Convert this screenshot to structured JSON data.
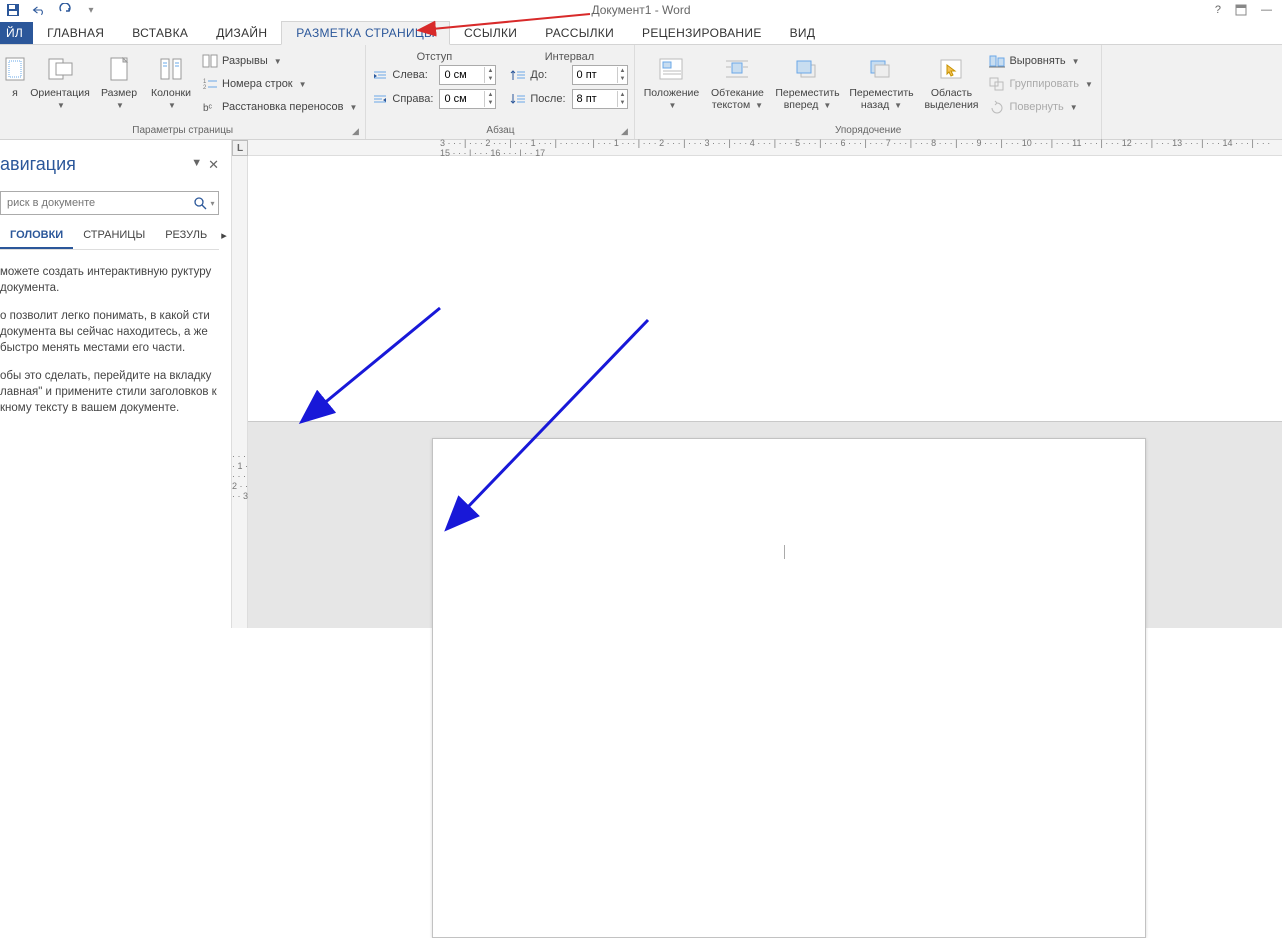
{
  "title": "Документ1 - Word",
  "tabs": {
    "file": "йл",
    "home": "ГЛАВНАЯ",
    "insert": "ВСТАВКА",
    "design": "ДИЗАЙН",
    "layout": "РАЗМЕТКА СТРАНИЦЫ",
    "links": "ССЫЛКИ",
    "mailings": "РАССЫЛКИ",
    "review": "РЕЦЕНЗИРОВАНИЕ",
    "view": "ВИД"
  },
  "ribbon": {
    "page_setup": {
      "margins_btn": "я",
      "orientation": "Ориентация",
      "size": "Размер",
      "columns": "Колонки",
      "breaks": "Разрывы",
      "line_numbers": "Номера строк",
      "hyphenation": "Расстановка переносов",
      "group": "Параметры страницы"
    },
    "paragraph": {
      "indent_title": "Отступ",
      "indent_left_label": "Слева:",
      "indent_left_value": "0 см",
      "indent_right_label": "Справа:",
      "indent_right_value": "0 см",
      "spacing_title": "Интервал",
      "before_label": "До:",
      "before_value": "0 пт",
      "after_label": "После:",
      "after_value": "8 пт",
      "group": "Абзац"
    },
    "arrange": {
      "position": "Положение",
      "wrap": "Обтекание текстом",
      "forward": "Переместить вперед",
      "backward": "Переместить назад",
      "selection_pane_l1": "Область",
      "selection_pane_l2": "выделения",
      "align": "Выровнять",
      "group_btn": "Группировать",
      "rotate": "Повернуть",
      "group": "Упорядочение"
    }
  },
  "nav": {
    "title": "авигация",
    "search_placeholder": "риск в документе",
    "tab_headings": "ГОЛОВКИ",
    "tab_pages": "СТРАНИЦЫ",
    "tab_results": "РЕЗУЛЬ",
    "hint_p1": "можете создать интерактивную руктуру документа.",
    "hint_p2": "о позволит легко понимать, в какой сти документа вы сейчас находитесь, а же быстро менять местами его части.",
    "hint_p3": "обы это сделать, перейдите на вкладку лавная\" и примените стили заголовков к кному тексту в вашем документе."
  },
  "ruler": {
    "h_marks": "3 · · · | · · · 2 · · · | · · · 1 · · · | · · ·   · · · | · · · 1 · · · | · · · 2 · · · | · · · 3 · · · | · · · 4 · · · | · · · 5 · · · | · · · 6 · · · | · · · 7 · · · | · · · 8 · · · | · · · 9 · · · | · · · 10 · · · | · · · 11 · · · | · · · 12 · · · | · · · 13 · · · | · · · 14 · · · | · · · 15 · · · | · · · 16 · · · | · · 17",
    "v_marks": " · ·  · · 1 · ·  · · 2 · ·  · · 3"
  }
}
